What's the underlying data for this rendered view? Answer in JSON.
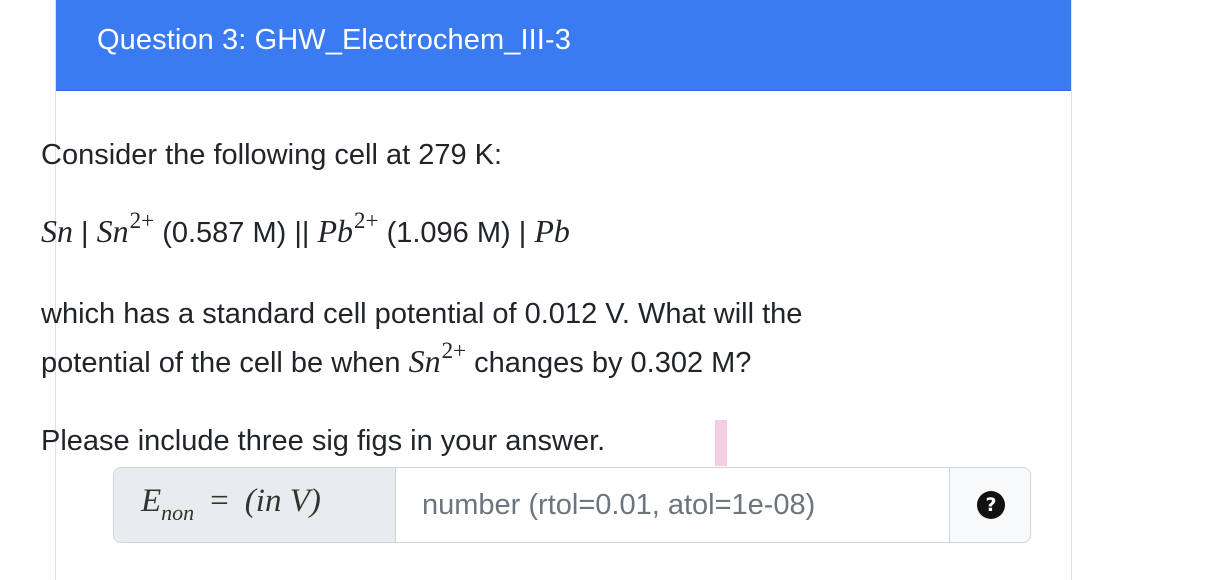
{
  "question": {
    "title": "Question 3: GHW_Electrochem_III-3",
    "intro": "Consider the following cell at 279 K:",
    "cell": {
      "anode": "Sn",
      "sep1": " | ",
      "anode_ion": "Sn",
      "charge": "2+",
      "anode_conc": " (0.587 M) || ",
      "cathode_ion": "Pb",
      "cathode_conc": " (1.096 M) | ",
      "cathode": "Pb"
    },
    "line1": "which has a standard cell potential of 0.012 V. What will the",
    "line2_pre": "potential of the cell be when ",
    "line2_ion": "Sn",
    "line2_post": " changes by 0.302 M?",
    "instruction": "Please include three sig figs in your answer."
  },
  "answer_field": {
    "symbol": "E",
    "subscript": "non",
    "equals": "=",
    "unit": "(in V)",
    "placeholder": "number (rtol=0.01, atol=1e-08)",
    "value": "",
    "help_glyph": "?"
  },
  "colors": {
    "header": "#3a7bf1",
    "header_text": "#ffffff",
    "prefix_bg": "#e9ecef"
  }
}
